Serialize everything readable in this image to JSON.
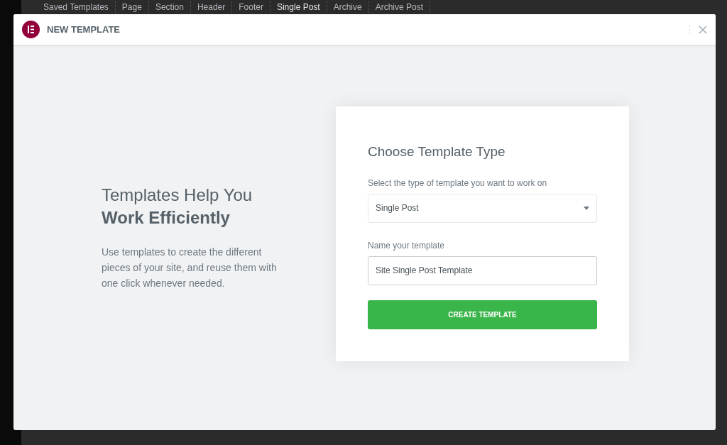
{
  "background_tabs": [
    {
      "label": "Saved Templates",
      "selected": false
    },
    {
      "label": "Page",
      "selected": false
    },
    {
      "label": "Section",
      "selected": false
    },
    {
      "label": "Header",
      "selected": false
    },
    {
      "label": "Footer",
      "selected": false
    },
    {
      "label": "Single Post",
      "selected": true
    },
    {
      "label": "Archive",
      "selected": false
    },
    {
      "label": "Archive Post",
      "selected": false
    }
  ],
  "modal": {
    "title": "NEW TEMPLATE",
    "intro": {
      "heading_light": "Templates Help You",
      "heading_bold": "Work Efficiently",
      "text": "Use templates to create the different pieces of your site, and reuse them with one click whenever needed."
    },
    "form": {
      "title": "Choose Template Type",
      "type_label": "Select the type of template you want to work on",
      "type_value": "Single Post",
      "name_label": "Name your template",
      "name_value": "Site Single Post Template",
      "submit": "CREATE TEMPLATE"
    }
  }
}
